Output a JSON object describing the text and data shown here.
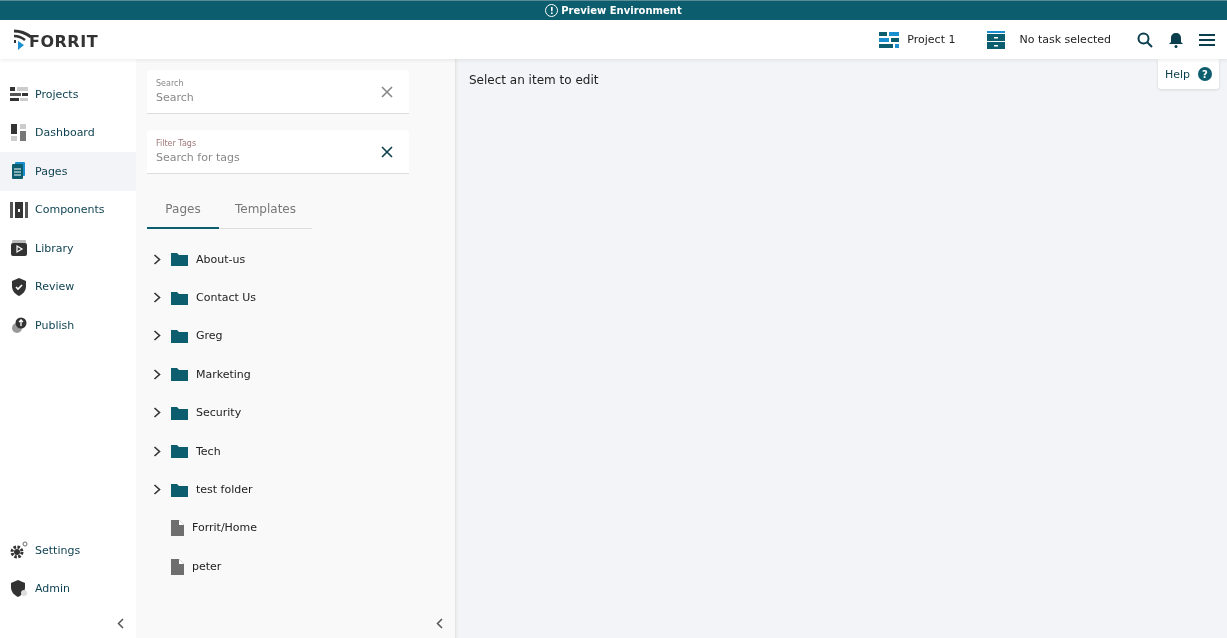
{
  "banner": {
    "icon": "!",
    "text": "Preview Environment"
  },
  "header": {
    "logo": "FORRIT",
    "project": "Project 1",
    "task": "No task selected"
  },
  "nav": [
    {
      "kind": "projects",
      "label": "Projects",
      "selected": false
    },
    {
      "kind": "dashboard",
      "label": "Dashboard",
      "selected": false
    },
    {
      "kind": "pages",
      "label": "Pages",
      "selected": true
    },
    {
      "kind": "components",
      "label": "Components",
      "selected": false
    },
    {
      "kind": "library",
      "label": "Library",
      "selected": false
    },
    {
      "kind": "review",
      "label": "Review",
      "selected": false
    },
    {
      "kind": "publish",
      "label": "Publish",
      "selected": false
    }
  ],
  "nav_bottom": [
    {
      "kind": "settings",
      "label": "Settings",
      "selected": false
    },
    {
      "kind": "admin",
      "label": "Admin",
      "selected": false
    }
  ],
  "search": {
    "label": "Search",
    "placeholder": "Search"
  },
  "filter_tags": {
    "label": "Filter Tags",
    "placeholder": "Search for tags"
  },
  "tabs": [
    {
      "label": "Pages",
      "selected": true
    },
    {
      "label": "Templates",
      "selected": false
    }
  ],
  "tree": [
    {
      "kind": "folder",
      "label": "About-us",
      "expanded": false
    },
    {
      "kind": "folder",
      "label": "Contact Us",
      "expanded": false
    },
    {
      "kind": "folder",
      "label": "Greg",
      "expanded": false
    },
    {
      "kind": "folder",
      "label": "Marketing",
      "expanded": false
    },
    {
      "kind": "folder",
      "label": "Security",
      "expanded": false
    },
    {
      "kind": "folder",
      "label": "Tech",
      "expanded": false
    },
    {
      "kind": "folder",
      "label": "test folder",
      "expanded": false
    },
    {
      "kind": "page",
      "label": "Forrit/Home"
    },
    {
      "kind": "page",
      "label": "peter"
    }
  ],
  "main": {
    "message": "Select an item to edit",
    "help": "Help",
    "help_icon": "?"
  }
}
